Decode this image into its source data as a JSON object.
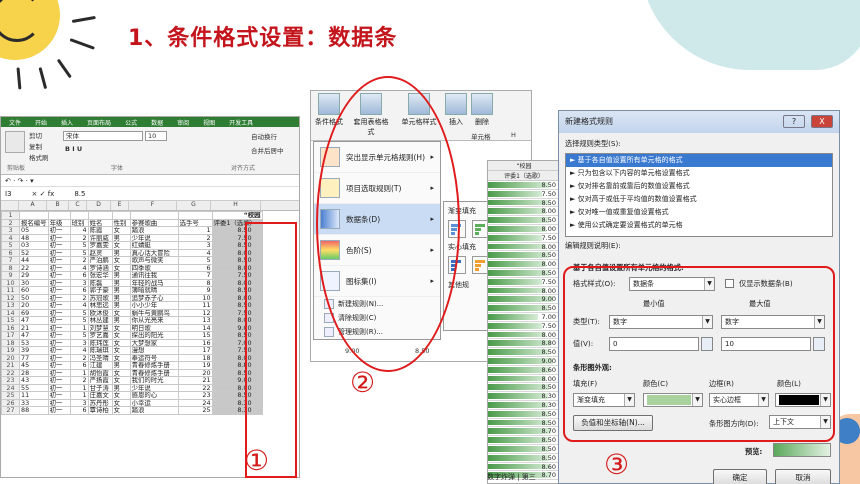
{
  "title": "1、条件格式设置：数据条",
  "markers": [
    "①",
    "②",
    "③"
  ],
  "excel": {
    "tabs": [
      "文件",
      "开始",
      "插入",
      "页面布局",
      "公式",
      "数据",
      "审阅",
      "视图",
      "开发工具"
    ],
    "clipboard": [
      "剪切",
      "复制",
      "格式刷"
    ],
    "font_name": "宋体",
    "font_size": "10",
    "font_buttons": "B I U",
    "merge": "合并后居中",
    "wrap": "自动换行",
    "groups": [
      "剪贴板",
      "字体",
      "对齐方式"
    ],
    "name_box": "I3",
    "formula": "8.5",
    "col_letters": [
      "A",
      "B",
      "C",
      "D",
      "E",
      "F",
      "G",
      "H"
    ],
    "header_row": [
      "报名编号",
      "年级",
      "班别",
      "姓名",
      "性别",
      "参赛歌曲",
      "选手号",
      "评委1（选歌）"
    ],
    "column_title": "“校园",
    "rows": [
      [
        "3",
        "05",
        "初一",
        "4",
        "陈霞",
        "女",
        "踏浪",
        "1",
        "8.50"
      ],
      [
        "4",
        "48",
        "初一",
        "2",
        "许丽威",
        "男",
        "少年说",
        "2",
        "7.50"
      ],
      [
        "5",
        "03",
        "初一",
        "5",
        "罗嘉雯",
        "女",
        "红蜻蜓",
        "3",
        "8.50"
      ],
      [
        "6",
        "52",
        "初一",
        "5",
        "赵灵",
        "男",
        "真心话大冒险",
        "4",
        "8.00"
      ],
      [
        "7",
        "44",
        "初一",
        "2",
        "严泊鹏",
        "女",
        "歌声与微笑",
        "5",
        "8.50"
      ],
      [
        "8",
        "22",
        "初一",
        "4",
        "罗诗涵",
        "女",
        "四季歌",
        "6",
        "8.00"
      ],
      [
        "9",
        "29",
        "初一",
        "6",
        "张宏华",
        "男",
        "通讯往我",
        "7",
        "7.50"
      ],
      [
        "10",
        "30",
        "初一",
        "3",
        "陈磊",
        "男",
        "年轻的战马",
        "8",
        "8.00"
      ],
      [
        "11",
        "60",
        "初一",
        "6",
        "郭子豪",
        "男",
        "簿暗就晴",
        "9",
        "8.50"
      ],
      [
        "12",
        "50",
        "初一",
        "2",
        "苏冠歌",
        "男",
        "追梦赤子心",
        "10",
        "8.00"
      ],
      [
        "13",
        "20",
        "初一",
        "4",
        "林思远",
        "男",
        "小小少年",
        "11",
        "8.50"
      ],
      [
        "14",
        "69",
        "初一",
        "5",
        "欧沐俊",
        "女",
        "蜗牛与黄鹂鸟",
        "12",
        "7.50"
      ],
      [
        "15",
        "47",
        "初一",
        "5",
        "林丛建",
        "男",
        "你从光亮来",
        "13",
        "8.00"
      ],
      [
        "16",
        "21",
        "初一",
        "1",
        "刘梦慧",
        "女",
        "明日歌",
        "14",
        "9.00"
      ],
      [
        "17",
        "47",
        "初一",
        "5",
        "罗艺嘉",
        "女",
        "探出的阳光",
        "15",
        "8.50"
      ],
      [
        "18",
        "53",
        "初一",
        "3",
        "陈玮莲",
        "女",
        "大梦想家",
        "16",
        "7.00"
      ],
      [
        "19",
        "39",
        "初一",
        "4",
        "陈瑞琪",
        "女",
        "漫想",
        "17",
        "7.50"
      ],
      [
        "20",
        "77",
        "初一",
        "2",
        "冯圣晴",
        "女",
        "奉运符号",
        "18",
        "8.00"
      ],
      [
        "21",
        "45",
        "初一",
        "6",
        "江建",
        "男",
        "青春修炼手册",
        "19",
        "8.80"
      ],
      [
        "22",
        "28",
        "初一",
        "1",
        "胡怡霞",
        "女",
        "青春修炼手册",
        "20",
        "8.50"
      ],
      [
        "23",
        "43",
        "初一",
        "2",
        "严扬霞",
        "女",
        "我们的时光",
        "21",
        "9.00"
      ],
      [
        "24",
        "55",
        "初一",
        "1",
        "甘子涛",
        "男",
        "少年说",
        "22",
        "8.00"
      ],
      [
        "25",
        "11",
        "初一",
        "1",
        "庄嘉文",
        "女",
        "感恩的心",
        "23",
        "8.50"
      ],
      [
        "26",
        "33",
        "初一",
        "3",
        "苏丹彤",
        "女",
        "小幸运",
        "24",
        "8.30"
      ],
      [
        "27",
        "88",
        "初一",
        "6",
        "覃诗柏",
        "女",
        "踏浪",
        "25",
        "8.30"
      ]
    ]
  },
  "menu": {
    "ribbon": [
      "条件格式",
      "套用表格格式",
      "单元格样式",
      "插入",
      "删除"
    ],
    "extra": "单元格",
    "col_h": "H",
    "items": [
      "突出显示单元格规则(H)",
      "项目选取规则(T)",
      "数据条(D)",
      "色阶(S)",
      "图标集(I)"
    ],
    "small_items": [
      "新建规则(N)...",
      "清除规则(C)",
      "管理规则(R)..."
    ],
    "submenu_gradient": "渐变填充",
    "submenu_solid": "实心填充",
    "other": "其他规",
    "bottom_vals": [
      "9.00",
      "8.50"
    ]
  },
  "strip": {
    "head": "“校园",
    "subhead": "评委1（选歌）",
    "values": [
      "8.50",
      "7.50",
      "8.50",
      "8.00",
      "8.50",
      "8.00",
      "7.50",
      "8.00",
      "8.50",
      "8.00",
      "8.50",
      "7.50",
      "8.00",
      "9.00",
      "8.50",
      "7.00",
      "7.50",
      "8.00",
      "8.80",
      "8.50",
      "9.00",
      "8.60",
      "8.00",
      "8.50",
      "8.30",
      "8.30",
      "8.50",
      "8.50",
      "8.70",
      "8.50",
      "8.50",
      "8.50",
      "8.60",
      "8.70"
    ],
    "footer": "数字炸弹 | 第三"
  },
  "dialog": {
    "title": "新建格式规则",
    "help": "?",
    "close": "X",
    "select_label": "选择规则类型(S):",
    "rule_types": [
      "► 基于各自值设置所有单元格的格式",
      "► 只为包含以下内容的单元格设置格式",
      "► 仅对排名靠前或靠后的数值设置格式",
      "► 仅对高于或低于平均值的数值设置格式",
      "► 仅对唯一值或重复值设置格式",
      "► 使用公式确定要设置格式的单元格"
    ],
    "edit_label": "编辑规则说明(E):",
    "based_label": "基于各自值设置所有单元格的格式:",
    "style_label": "格式样式(O):",
    "style_value": "数据条",
    "show_bar_only": "仅显示数据条(B)",
    "min_label": "最小值",
    "max_label": "最大值",
    "type_label": "类型(T):",
    "type_min": "数字",
    "type_max": "数字",
    "value_label": "值(V):",
    "value_min": "0",
    "value_max": "10",
    "bar_appearance": "条形图外观:",
    "fill_label": "填充(F)",
    "color_label": "颜色(C)",
    "border_label": "边框(R)",
    "color2_label": "颜色(L)",
    "fill_value": "渐变填充",
    "border_value": "实心边框",
    "neg_button": "负值和坐标轴(N)...",
    "dir_label": "条形图方向(D):",
    "dir_value": "上下文",
    "preview_label": "预览:",
    "ok": "确定",
    "cancel": "取消",
    "fill_color": "#a9d39e",
    "border_color": "#000000"
  }
}
